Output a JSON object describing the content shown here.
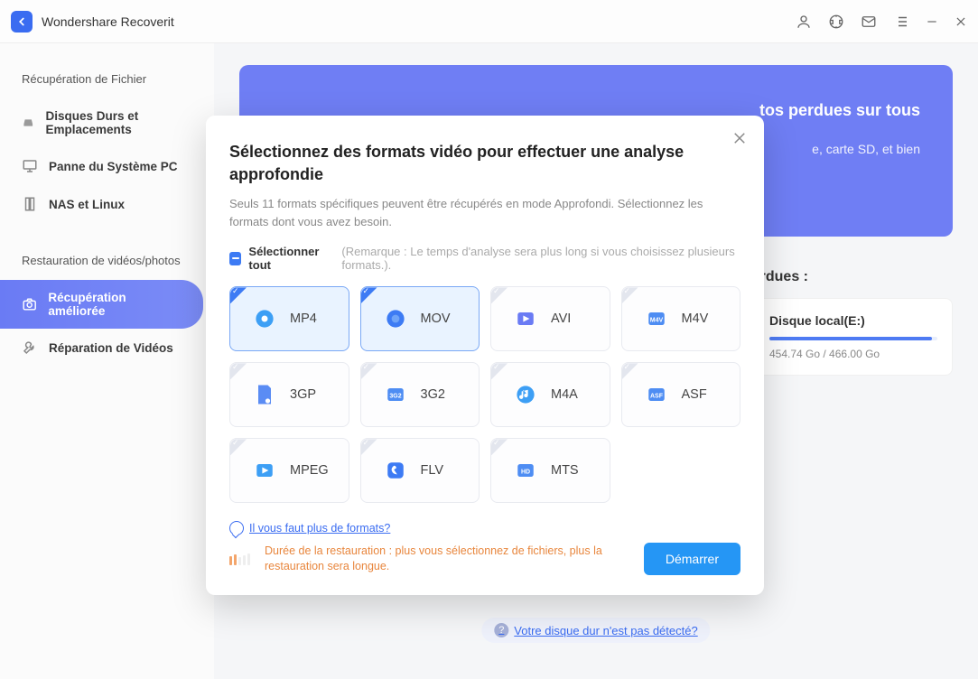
{
  "app": {
    "title": "Wondershare Recoverit"
  },
  "sidebar": {
    "section1": "Récupération de Fichier",
    "items1": [
      {
        "label": "Disques Durs et Emplacements"
      },
      {
        "label": "Panne du Système PC"
      },
      {
        "label": "NAS et Linux"
      }
    ],
    "section2": "Restauration de vidéos/photos",
    "items2": [
      {
        "label": "Récupération améliorée"
      },
      {
        "label": "Réparation de Vidéos"
      }
    ]
  },
  "banner": {
    "fragment1": "tos perdues sur tous",
    "fragment2": "e, carte SD, et bien"
  },
  "section_heading": "erdues :",
  "disk": {
    "name": "Disque local(E:)",
    "usage": "454.74 Go / 466.00 Go"
  },
  "detect": "Votre disque dur n'est pas détecté?",
  "modal": {
    "title": "Sélectionnez des formats vidéo pour effectuer une analyse approfondie",
    "subtitle": "Seuls 11 formats spécifiques peuvent être récupérés en mode Approfondi. Sélectionnez les formats dont vous avez besoin.",
    "select_all": "Sélectionner tout",
    "select_note": "(Remarque : Le temps d'analyse sera plus long si vous choisissez plusieurs formats.).",
    "formats": [
      {
        "label": "MP4",
        "selected": true
      },
      {
        "label": "MOV",
        "selected": true
      },
      {
        "label": "AVI",
        "selected": false
      },
      {
        "label": "M4V",
        "selected": false
      },
      {
        "label": "3GP",
        "selected": false
      },
      {
        "label": "3G2",
        "selected": false
      },
      {
        "label": "M4A",
        "selected": false
      },
      {
        "label": "ASF",
        "selected": false
      },
      {
        "label": "MPEG",
        "selected": false
      },
      {
        "label": "FLV",
        "selected": false
      },
      {
        "label": "MTS",
        "selected": false
      }
    ],
    "need_more": "Il vous faut plus de formats?",
    "duration": "Durée de la restauration : plus vous sélectionnez de fichiers, plus la restauration sera longue.",
    "start": "Démarrer"
  }
}
